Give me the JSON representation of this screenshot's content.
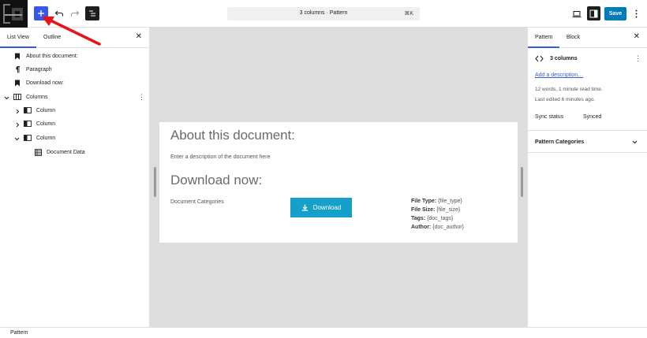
{
  "toolbar": {
    "command_title": "3 columns · Pattern",
    "command_shortcut": "⌘K",
    "save_label": "Save"
  },
  "left_panel": {
    "tabs": [
      "List View",
      "Outline"
    ],
    "items": [
      {
        "label": "About this document:",
        "icon": "bookmark-icon"
      },
      {
        "label": "Paragraph",
        "icon": "paragraph-icon"
      },
      {
        "label": "Download now:",
        "icon": "bookmark-icon"
      },
      {
        "label": "Columns",
        "icon": "columns-icon"
      },
      {
        "label": "Column",
        "icon": "column-icon"
      },
      {
        "label": "Column",
        "icon": "column-icon"
      },
      {
        "label": "Column",
        "icon": "column-icon"
      },
      {
        "label": "Document Data",
        "icon": "table-icon"
      }
    ]
  },
  "document": {
    "heading1": "About this document:",
    "description": "Enter a description of the document here",
    "heading2": "Download now:",
    "categories": "Document Categories",
    "download_label": "Download",
    "meta": [
      {
        "label": "File Type:",
        "value": "{file_type}"
      },
      {
        "label": "File Size:",
        "value": "{file_size}"
      },
      {
        "label": "Tags:",
        "value": "{doc_tags}"
      },
      {
        "label": "Author:",
        "value": "{doc_author}"
      }
    ]
  },
  "right_panel": {
    "tabs": [
      "Pattern",
      "Block"
    ],
    "pattern_title": "3 columns",
    "add_description": "Add a description…",
    "stats": "12 words, 1 minute read time.",
    "last_edited": "Last edited 6 minutes ago.",
    "sync_status_label": "Sync status",
    "sync_status_value": "Synced",
    "categories_label": "Pattern Categories"
  },
  "footer": {
    "breadcrumb": "Pattern"
  },
  "colors": {
    "accent": "#3858e9",
    "download_button": "#14a0c8",
    "annotation_arrow": "#e8141c"
  }
}
